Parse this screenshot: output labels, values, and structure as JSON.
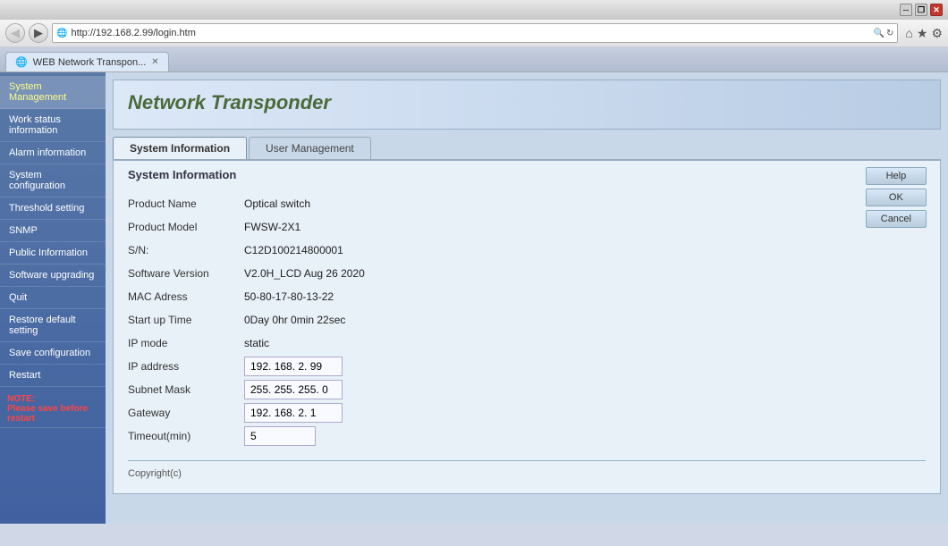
{
  "browser": {
    "address": "http://192.168.2.99/login.htm",
    "tab_label": "WEB Network Transpon...",
    "title_buttons": {
      "minimize": "─",
      "restore": "❐",
      "close": "✕"
    },
    "back_icon": "◀",
    "forward_icon": "▶",
    "refresh_icon": "↻",
    "home_icon": "⌂",
    "favorites_icon": "★",
    "settings_icon": "⚙"
  },
  "app": {
    "title": "Network Transponder",
    "tabs": [
      {
        "id": "system-info",
        "label": "System Information",
        "active": true
      },
      {
        "id": "user-mgmt",
        "label": "User Management",
        "active": false
      }
    ]
  },
  "sidebar": {
    "items": [
      {
        "id": "system-management",
        "label": "System Management",
        "active": true
      },
      {
        "id": "work-status",
        "label": "Work status information",
        "active": false
      },
      {
        "id": "alarm-information",
        "label": "Alarm information",
        "active": false
      },
      {
        "id": "system-configuration",
        "label": "System configuration",
        "active": false
      },
      {
        "id": "threshold-setting",
        "label": "Threshold setting",
        "active": false
      },
      {
        "id": "snmp",
        "label": "SNMP",
        "active": false
      },
      {
        "id": "public-information",
        "label": "Public Information",
        "active": false
      },
      {
        "id": "software-upgrading",
        "label": "Software upgrading",
        "active": false
      },
      {
        "id": "quit",
        "label": "Quit",
        "active": false
      },
      {
        "id": "restore-default",
        "label": "Restore default setting",
        "active": false
      },
      {
        "id": "save-configuration",
        "label": "Save configuration",
        "active": false
      },
      {
        "id": "restart",
        "label": "Restart",
        "active": false
      }
    ],
    "note": {
      "label": "NOTE:",
      "text": "Please save before restart"
    }
  },
  "panel": {
    "title": "System Information",
    "fields": [
      {
        "label": "Product Name",
        "value": "Optical switch",
        "type": "text"
      },
      {
        "label": "Product Model",
        "value": "FWSW-2X1",
        "type": "text"
      },
      {
        "label": "S/N:",
        "value": "C12D100214800001",
        "type": "text"
      },
      {
        "label": "Software Version",
        "value": "V2.0H_LCD Aug 26 2020",
        "type": "text"
      },
      {
        "label": "MAC Adress",
        "value": "50-80-17-80-13-22",
        "type": "text"
      },
      {
        "label": "Start up Time",
        "value": "0Day 0hr 0min 22sec",
        "type": "text"
      },
      {
        "label": "IP mode",
        "value": "static",
        "type": "text"
      },
      {
        "label": "IP address",
        "value": "192. 168. 2. 99",
        "type": "input"
      },
      {
        "label": "Subnet Mask",
        "value": "255. 255. 255. 0",
        "type": "input"
      },
      {
        "label": "Gateway",
        "value": "192. 168. 2. 1",
        "type": "input"
      },
      {
        "label": "Timeout(min)",
        "value": "5",
        "type": "input"
      }
    ],
    "buttons": [
      {
        "id": "help",
        "label": "Help"
      },
      {
        "id": "ok",
        "label": "OK"
      },
      {
        "id": "cancel",
        "label": "Cancel"
      }
    ],
    "copyright": "Copyright(c)"
  }
}
